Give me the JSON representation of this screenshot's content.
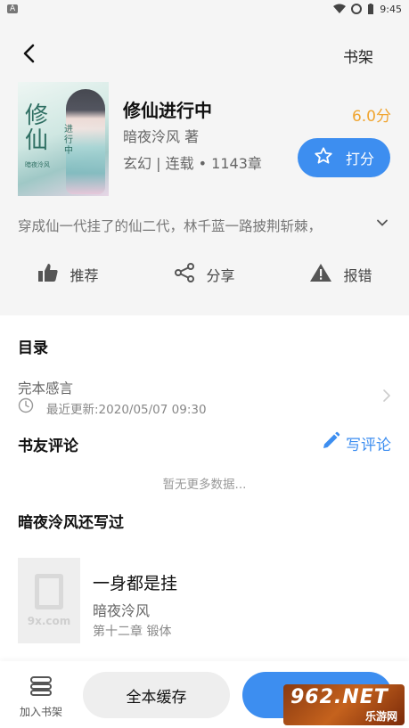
{
  "status_bar": {
    "left_badge": "A",
    "time": "9:45"
  },
  "topbar": {
    "shelf_label": "书架"
  },
  "book": {
    "title": "修仙进行中",
    "author": "暗夜泠风 著",
    "meta": "玄幻 | 连载 • 1143章",
    "score": "6.0分",
    "rate_label": "打分",
    "synopsis": "穿成仙一代挂了的仙二代，林千蓝一路披荆斩棘，",
    "cover": {
      "title": "修仙",
      "subtitle": "进行中",
      "author": "暗夜泠风"
    }
  },
  "actions": [
    {
      "label": "推荐",
      "icon": "thumbs-up-icon"
    },
    {
      "label": "分享",
      "icon": "share-icon"
    },
    {
      "label": "报错",
      "icon": "warning-icon"
    }
  ],
  "toc": {
    "title": "目录",
    "latest_chapter": "完本感言",
    "updated": "最近更新:2020/05/07 09:30"
  },
  "reviews": {
    "title": "书友评论",
    "write_label": "写评论",
    "empty_text": "暂无更多数据..."
  },
  "other_works": {
    "title": "暗夜泠风还写过",
    "items": [
      {
        "title": "一身都是挂",
        "author": "暗夜泠风",
        "chapter": "第十二章 锻体",
        "cover_watermark": "9x.com"
      }
    ]
  },
  "bottom": {
    "add_shelf_label": "加入书架",
    "cache_label": "全本缓存"
  },
  "watermark": {
    "brand": "962.NET",
    "sub": "乐游网"
  },
  "colors": {
    "accent": "#3d8ef0",
    "score": "#f0a530",
    "panel_bg": "#f5f5f5"
  }
}
